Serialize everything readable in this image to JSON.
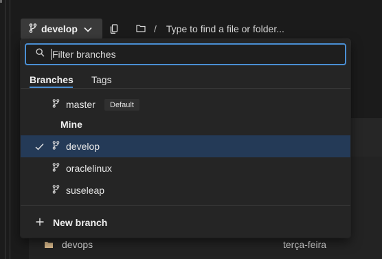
{
  "toolbar": {
    "branch_label": "develop",
    "path_separator": "/",
    "path_placeholder": "Type to find a file or folder..."
  },
  "dropdown": {
    "filter_placeholder": "Filter branches",
    "tabs": [
      {
        "label": "Branches",
        "active": true
      },
      {
        "label": "Tags",
        "active": false
      }
    ],
    "default_branch": {
      "label": "master",
      "badge": "Default"
    },
    "section_mine": "Mine",
    "mine_items": [
      {
        "label": "develop",
        "selected": true
      },
      {
        "label": "oraclelinux",
        "selected": false
      },
      {
        "label": "suseleap",
        "selected": false
      }
    ],
    "new_branch_label": "New branch"
  },
  "file_list": {
    "rows": [
      {
        "name": "devops",
        "modified": "terça-feira"
      }
    ]
  },
  "icons": {
    "branch": "git-branch-icon",
    "chevron": "chevron-down-icon",
    "copy": "copy-icon",
    "folder": "folder-icon",
    "search": "search-icon",
    "check": "check-icon",
    "plus": "plus-icon"
  },
  "colors": {
    "accent": "#4a8fd4",
    "selected_row": "#243a57",
    "background": "#1b1b1b",
    "dropdown_bg": "#252525"
  }
}
